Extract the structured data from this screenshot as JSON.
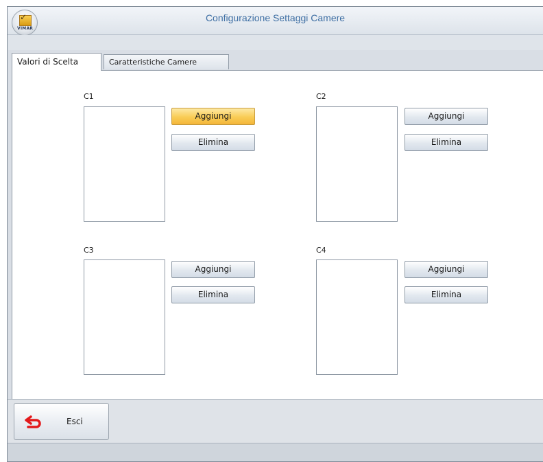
{
  "window": {
    "title": "Configurazione Settaggi Camere",
    "logo_text": "VIMAR",
    "logo_icon": "vimar-logo-icon"
  },
  "tabs": [
    {
      "label": "Valori di Scelta",
      "active": true
    },
    {
      "label": "Caratteristiche Camere",
      "active": false
    }
  ],
  "groups": [
    {
      "label": "C1",
      "add_label": "Aggiungi",
      "delete_label": "Elimina",
      "add_hovered": true
    },
    {
      "label": "C2",
      "add_label": "Aggiungi",
      "delete_label": "Elimina",
      "add_hovered": false
    },
    {
      "label": "C3",
      "add_label": "Aggiungi",
      "delete_label": "Elimina",
      "add_hovered": false
    },
    {
      "label": "C4",
      "add_label": "Aggiungi",
      "delete_label": "Elimina",
      "add_hovered": false
    }
  ],
  "footer": {
    "exit_label": "Esci",
    "exit_icon": "back-arrow-icon"
  },
  "colors": {
    "title_text": "#3d6ea3",
    "hover_button": "#f9cc55",
    "exit_arrow": "#e3191b"
  }
}
